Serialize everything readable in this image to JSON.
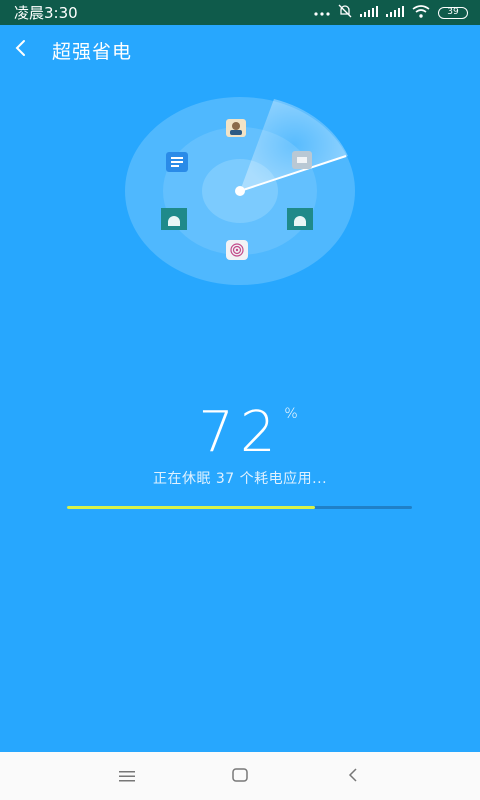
{
  "status_bar": {
    "time": "凌晨3:30",
    "battery_level": "39",
    "icons": [
      "more-dots-icon",
      "alarm-off-icon",
      "signal-icon",
      "signal-icon",
      "wifi-icon",
      "battery-icon"
    ]
  },
  "app_bar": {
    "title": "超强省电",
    "back_icon": "back-arrow-icon"
  },
  "radar": {
    "apps": [
      "contact-app-icon",
      "notes-app-icon",
      "gray-app-icon",
      "android-app-icon",
      "android-app-icon",
      "fingerprint-app-icon"
    ]
  },
  "progress": {
    "percent_value": "72",
    "percent_sign": "%",
    "status_text": "正在休眠 37 个耗电应用...",
    "fraction": 0.72,
    "fill_color": "#d6f24a",
    "track_color": "#1f80c8"
  },
  "nav_bar": {
    "icons": [
      "menu-icon",
      "home-icon",
      "back-icon"
    ]
  },
  "colors": {
    "background": "#27a7fe",
    "status_bar": "#0f5b4b"
  }
}
